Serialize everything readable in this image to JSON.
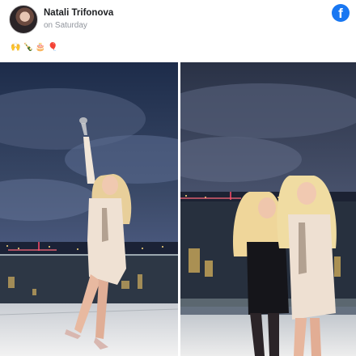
{
  "post": {
    "author": "Natali Trifonova",
    "timestamp": "on Saturday",
    "emojis": [
      "🙌",
      "🍾",
      "🎂",
      "🎈"
    ]
  },
  "brand": {
    "logo_letter": "f",
    "color": "#1877f2"
  },
  "photos": [
    {
      "name": "rooftop-photo-left",
      "icon": "photo"
    },
    {
      "name": "rooftop-photo-right",
      "icon": "photo"
    }
  ]
}
